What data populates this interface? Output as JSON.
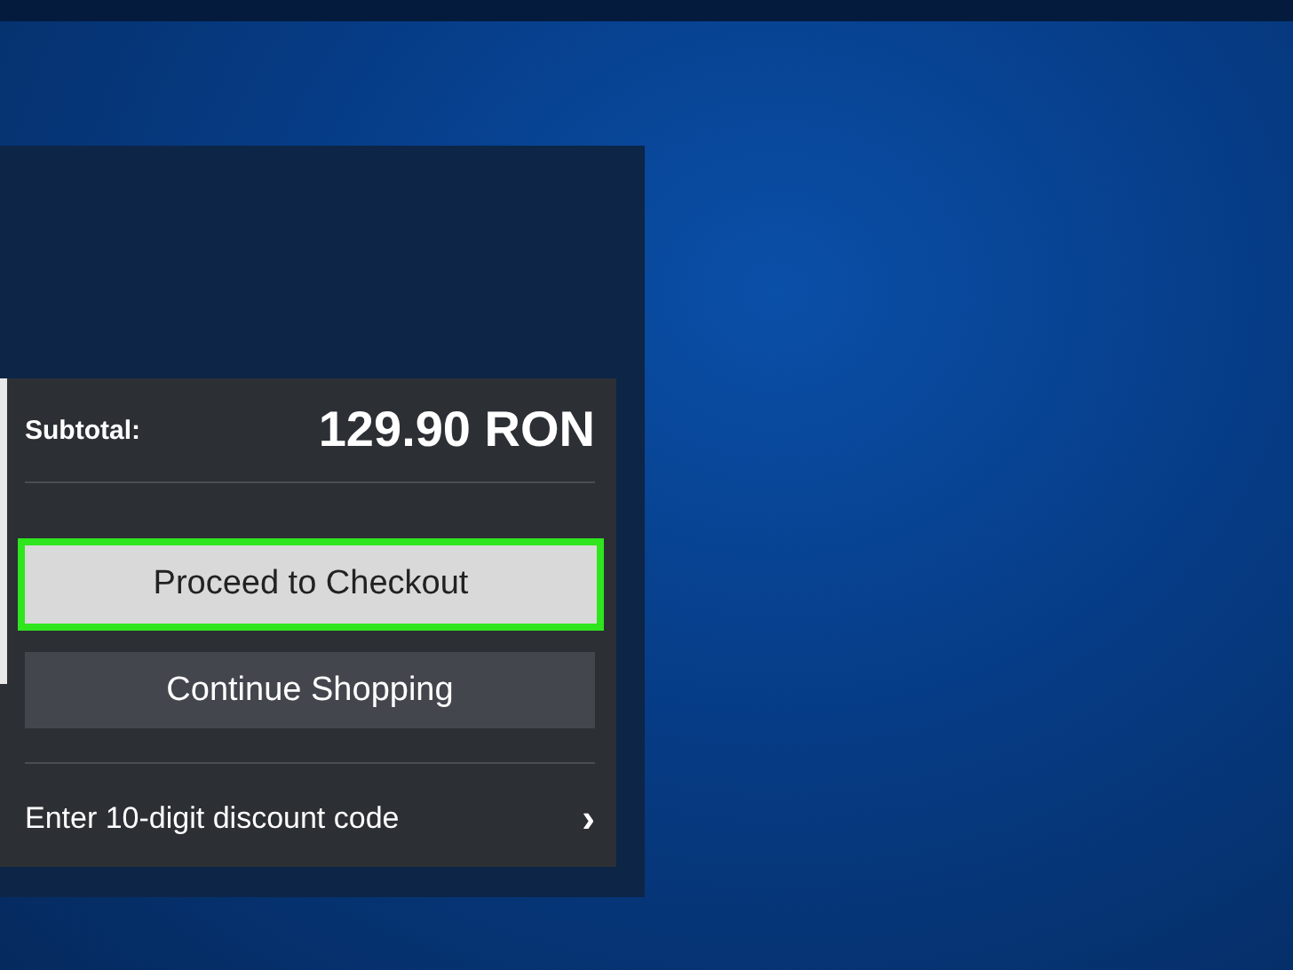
{
  "subtotal": {
    "label": "Subtotal:",
    "amount": "129.90 RON"
  },
  "buttons": [
    {
      "label": "Proceed to Checkout",
      "kind": "primary",
      "highlighted": true
    },
    {
      "label": "Continue Shopping",
      "kind": "secondary",
      "highlighted": false
    }
  ],
  "discount": {
    "label": "Enter 10-digit discount code",
    "arrow": "›"
  }
}
